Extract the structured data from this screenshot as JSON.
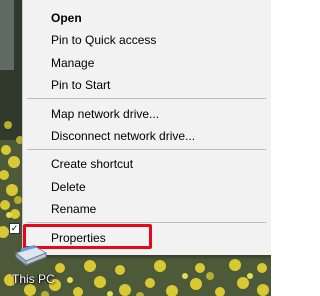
{
  "context_menu": {
    "items": [
      {
        "label": "Open",
        "bold": true
      },
      {
        "label": "Pin to Quick access"
      },
      {
        "label": "Manage"
      },
      {
        "label": "Pin to Start"
      },
      {
        "label": "Map network drive..."
      },
      {
        "label": "Disconnect network drive..."
      },
      {
        "label": "Create shortcut"
      },
      {
        "label": "Delete"
      },
      {
        "label": "Rename"
      },
      {
        "label": "Properties",
        "highlighted": true
      }
    ],
    "highlight_color": "#e3081a"
  },
  "desktop": {
    "icon_label": "This PC",
    "icon": "computer-icon",
    "selection_checkbox": "✓"
  }
}
